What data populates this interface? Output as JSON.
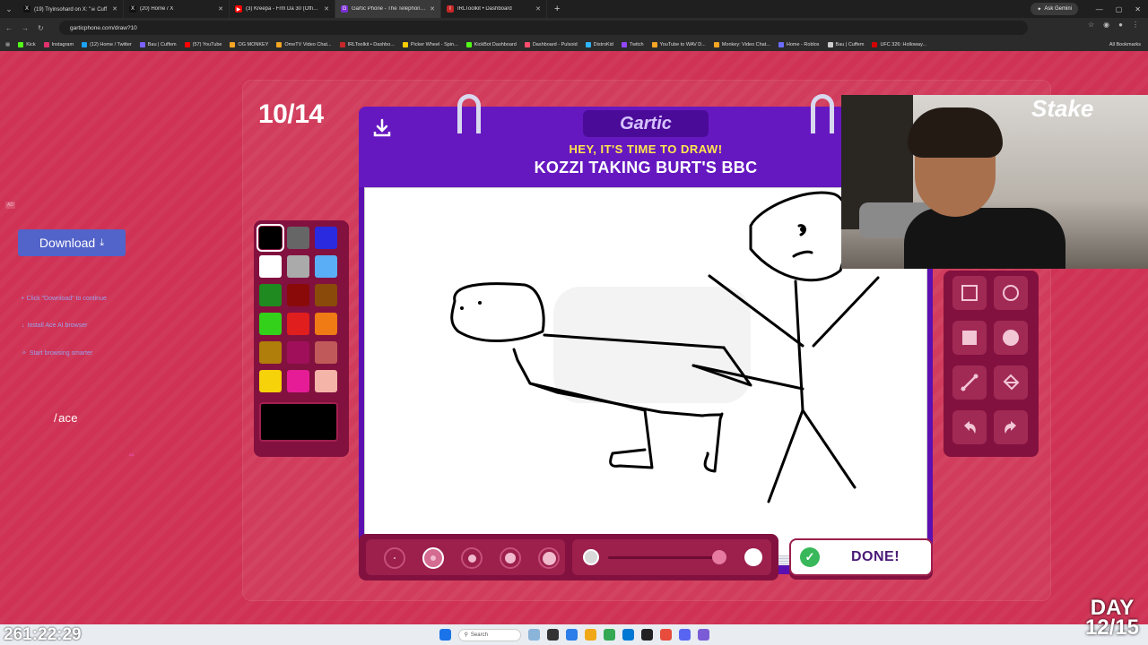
{
  "browser": {
    "tabs": [
      {
        "title": "(19) Tryinsohard on X: \"☠ Cuff",
        "color": "#111111",
        "glyph": "X",
        "active": false
      },
      {
        "title": "(20) Home / X",
        "color": "#111111",
        "glyph": "X",
        "active": false
      },
      {
        "title": "(3) Kreepa - Frm Da 30 (Official",
        "color": "#ff0000",
        "glyph": "▶",
        "active": false
      },
      {
        "title": "Gartic Phone - The Telephone G",
        "color": "#7b2fd6",
        "glyph": "G",
        "active": true
      },
      {
        "title": "IRLToolkit • Dashboard",
        "color": "#c62828",
        "glyph": "I",
        "active": false
      }
    ],
    "ask_button": "Ask Gemini",
    "url": "garticphone.com/draw?10",
    "bookmarks": [
      {
        "label": "Kick",
        "color": "#53fc18"
      },
      {
        "label": "Instagram",
        "color": "#e1306c"
      },
      {
        "label": "(12) Home / Twitter",
        "color": "#1da1f2"
      },
      {
        "label": "Bau | Cuffem",
        "color": "#7b61ff"
      },
      {
        "label": "(57) YouTube",
        "color": "#ff0000"
      },
      {
        "label": "OG MONKEY",
        "color": "#f5a623"
      },
      {
        "label": "OmeTV Video Chat...",
        "color": "#f5a623"
      },
      {
        "label": "IRLToolkit • Dashbo...",
        "color": "#c62828"
      },
      {
        "label": "Picker Wheel - Spin...",
        "color": "#ffcc00"
      },
      {
        "label": "KickBot Dashboard",
        "color": "#53fc18"
      },
      {
        "label": "Dashboard - Pulsoid",
        "color": "#ff4d6d"
      },
      {
        "label": "DistroKid",
        "color": "#2fb4ff"
      },
      {
        "label": "Twitch",
        "color": "#9146ff"
      },
      {
        "label": "YouTube to WAV D...",
        "color": "#f5a623"
      },
      {
        "label": "Monkey: Video Chat...",
        "color": "#f5a623"
      },
      {
        "label": "Home - Roblox",
        "color": "#6c6cff"
      },
      {
        "label": "Bau | Cuffem",
        "color": "#cccccc"
      },
      {
        "label": "UFC 326: Holloway...",
        "color": "#d40000"
      }
    ],
    "all_bookmarks": "All Bookmarks"
  },
  "ad": {
    "badge": "AD",
    "download_label": "Download",
    "steps": [
      {
        "icon": "•",
        "text": "Click \"Download\" to continue"
      },
      {
        "icon": "↓",
        "text": "Install Ace AI browser"
      },
      {
        "icon": "✧",
        "text": "Start browsing smarter"
      }
    ],
    "logo": "/ ace",
    "small": "AD"
  },
  "game": {
    "counter": "10/14",
    "brand": "Gartic",
    "prompt_sub": "HEY, IT'S TIME TO DRAW!",
    "prompt_main": "KOZZI TAKING BURT'S BBC",
    "done_label": "DONE!",
    "palette": [
      "#000000",
      "#666666",
      "#2a2ae0",
      "#ffffff",
      "#aaaaaa",
      "#5aaef5",
      "#1f8a1f",
      "#8a0a0a",
      "#8a4a0a",
      "#33d11a",
      "#e01e1e",
      "#f07a14",
      "#b07e0a",
      "#a0105a",
      "#c05a5a",
      "#f5d20a",
      "#e51c96",
      "#f5b4a8"
    ],
    "selected_color": "#000000",
    "brush_sizes": [
      2,
      6,
      9,
      12,
      15
    ],
    "selected_brush": 1,
    "opacity_level": 0.95
  },
  "overlay": {
    "sign": "Stake",
    "timer": "261:22:29",
    "day_line1": "DAY",
    "day_line2": "12/15"
  },
  "taskbar": {
    "search": "Search"
  }
}
